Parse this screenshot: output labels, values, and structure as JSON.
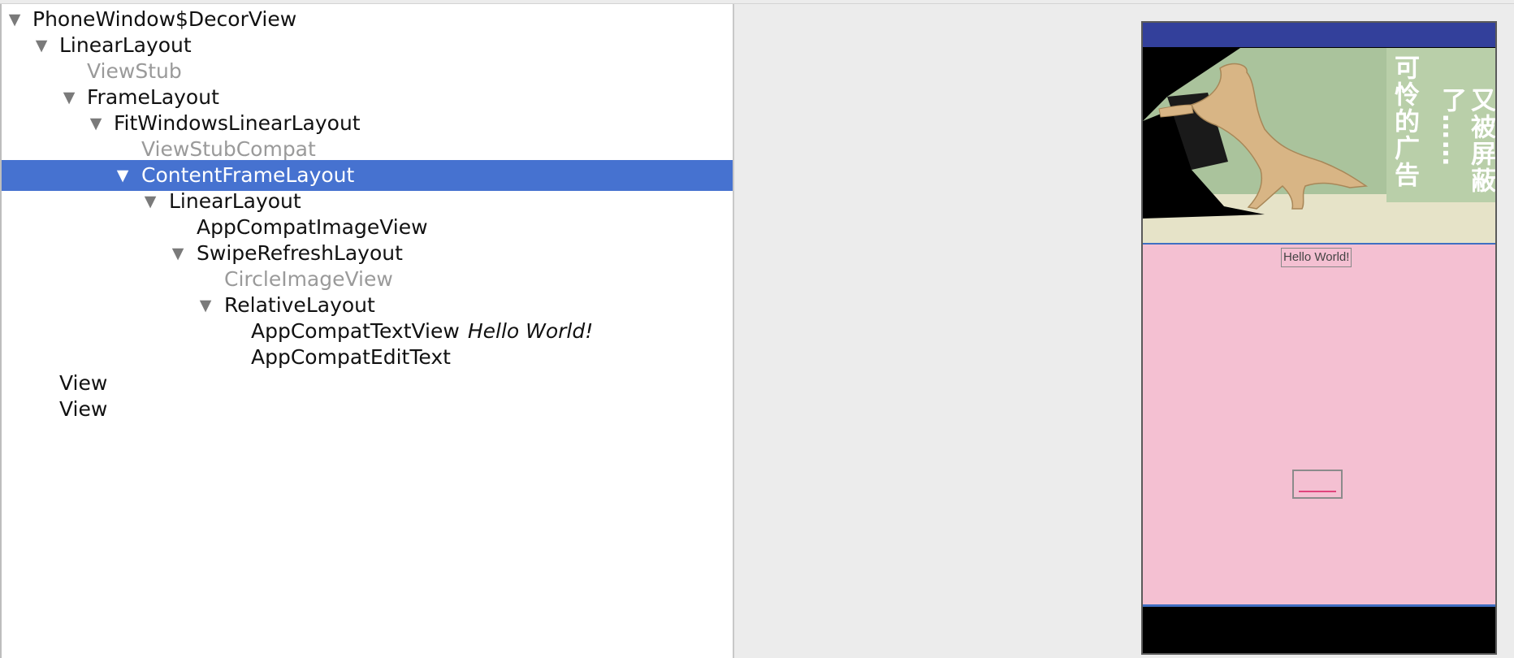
{
  "hierarchy": {
    "nodes": [
      {
        "label": "PhoneWindow$DecorView",
        "expandable": true
      },
      {
        "label": "LinearLayout",
        "expandable": true
      },
      {
        "label": "ViewStub",
        "expandable": false
      },
      {
        "label": "FrameLayout",
        "expandable": true
      },
      {
        "label": "FitWindowsLinearLayout",
        "expandable": true
      },
      {
        "label": "ViewStubCompat",
        "expandable": false
      },
      {
        "label": "ContentFrameLayout",
        "expandable": true,
        "selected": true
      },
      {
        "label": "LinearLayout",
        "expandable": true
      },
      {
        "label": "AppCompatImageView",
        "expandable": false
      },
      {
        "label": "SwipeRefreshLayout",
        "expandable": true
      },
      {
        "label": "CircleImageView",
        "expandable": false
      },
      {
        "label": "RelativeLayout",
        "expandable": true
      },
      {
        "label": "AppCompatTextView",
        "extra": "Hello World!",
        "expandable": false
      },
      {
        "label": "AppCompatEditText",
        "expandable": false
      },
      {
        "label": "View",
        "expandable": false
      },
      {
        "label": "View",
        "expandable": false
      }
    ],
    "toggle_glyph": "▼"
  },
  "preview": {
    "ad_text_line1": "可怜的广告",
    "ad_text_line2": "又被屏蔽了……",
    "hello_text": "Hello World!",
    "colors": {
      "status_bar": "#33409b",
      "content_background": "#f4c0d2",
      "edit_underline": "#e0457d",
      "selection": "#4672d0"
    }
  }
}
